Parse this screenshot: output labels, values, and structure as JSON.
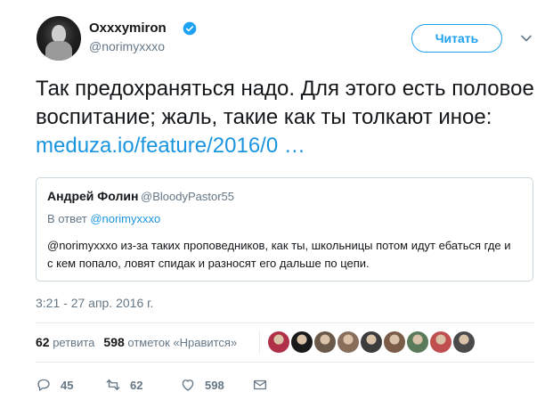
{
  "author": {
    "display_name": "Oxxxymiron",
    "handle": "@norimyxxxo",
    "avatar_icon": "avatar",
    "verified_icon": "verified-badge-icon"
  },
  "follow_button": {
    "label": "Читать"
  },
  "tweet": {
    "text": "Так предохраняться надо. Для этого есть половое воспитание; жаль, такие как ты толкают иное: ",
    "link_text": "meduza.io/feature/2016/0 …"
  },
  "quoted_tweet": {
    "author_name": "Андрей Фолин",
    "author_handle": "@BloodyPastor55",
    "reply_prefix": "В ответ ",
    "reply_to": "@norimyxxxo",
    "text": "@norimyxxxo из-за таких проповедников, как ты, школьницы потом идут ебаться где и с кем попало, ловят спидак и разносят его дальше по цепи."
  },
  "timestamp": "3:21 - 27 апр. 2016 г.",
  "stats": {
    "retweets_count": "62",
    "retweets_label": "ретвита",
    "likes_count": "598",
    "likes_label": "отметок «Нравится»"
  },
  "liker_avatars": [
    "#b0304a",
    "#1a1a1a",
    "#6b5a4a",
    "#8a6e5c",
    "#3c3c3c",
    "#7a5c48",
    "#5a7a5a",
    "#c05050",
    "#4a4a4a"
  ],
  "actions": {
    "reply_count": "45",
    "retweet_count": "62",
    "like_count": "598"
  },
  "colors": {
    "accent": "#1da1f2",
    "link": "#1b95e0",
    "muted": "#657786"
  }
}
